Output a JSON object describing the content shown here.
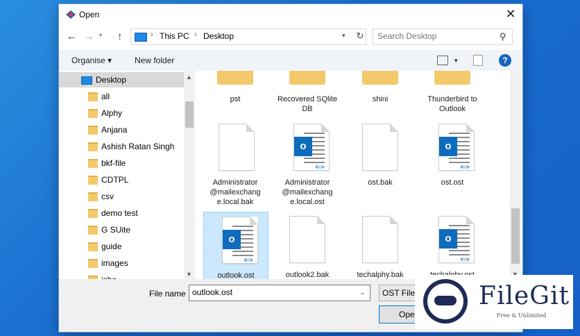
{
  "window": {
    "title": "Open"
  },
  "address": {
    "crumbs": [
      "This PC",
      "Desktop"
    ]
  },
  "search": {
    "placeholder": "Search Desktop"
  },
  "toolbar": {
    "organise": "Organise ▾",
    "new_folder": "New folder",
    "help": "?"
  },
  "nav": {
    "items": [
      "Desktop",
      "all",
      "Alphy",
      "Anjana",
      "Ashish Ratan Singh",
      "bkf-file",
      "CDTPL",
      "csv",
      "demo test",
      "G SUite",
      "guide",
      "images",
      "ishe"
    ]
  },
  "files": [
    {
      "name": "pst",
      "icon": "folder-icon"
    },
    {
      "name": "Recovered SQlite DB",
      "icon": "folder-icon"
    },
    {
      "name": "shini",
      "icon": "folder-icon"
    },
    {
      "name": "Thunderbird to Outlook",
      "icon": "folder-icon"
    },
    {
      "name": "Administrator @mailexchang e.local.bak",
      "icon": "blank-file-icon"
    },
    {
      "name": "Administrator @mailexchang e.local.ost",
      "icon": "outlook-file-icon"
    },
    {
      "name": "ost.bak",
      "icon": "blank-file-icon"
    },
    {
      "name": "ost.ost",
      "icon": "outlook-file-icon"
    },
    {
      "name": "outlook.ost",
      "icon": "outlook-file-icon"
    },
    {
      "name": "outlook2.bak",
      "icon": "blank-file-icon"
    },
    {
      "name": "techalphy.bak",
      "icon": "blank-file-icon"
    },
    {
      "name": "techalphy.ost",
      "icon": "outlook-file-icon"
    }
  ],
  "bottom": {
    "file_name_label": "File name",
    "file_name_value": "outlook.ost",
    "file_type": "OST Files(",
    "open_label": "Open"
  },
  "watermark": {
    "name": "FileGit",
    "tagline": "Free & Unlimited"
  },
  "colors": {
    "selection": "#cce8ff",
    "accent": "#0078d7",
    "outlook": "#0f6cbd"
  }
}
